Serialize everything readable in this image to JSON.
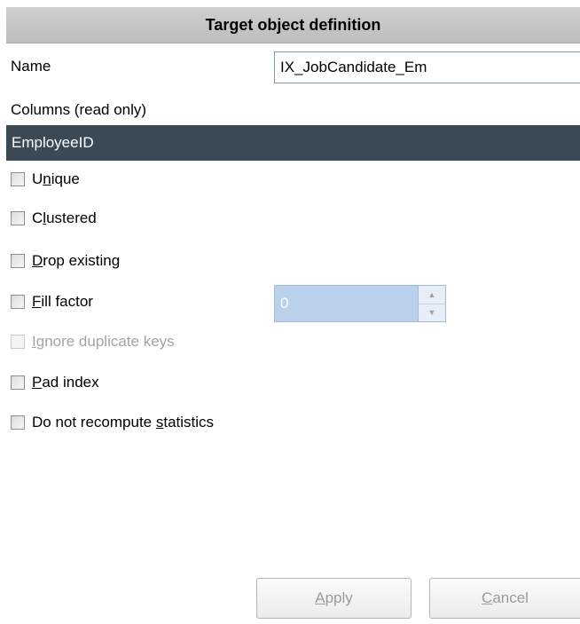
{
  "header": {
    "title": "Target object definition"
  },
  "name_field": {
    "label": "Name",
    "value": "IX_JobCandidate_Em"
  },
  "columns": {
    "label": "Columns (read only)",
    "items": [
      "EmployeeID"
    ]
  },
  "options": {
    "unique": {
      "pre": "U",
      "mnemonic": "n",
      "post": "ique",
      "checked": false
    },
    "clustered": {
      "pre": "C",
      "mnemonic": "l",
      "post": "ustered",
      "checked": false
    },
    "drop_existing": {
      "pre": "",
      "mnemonic": "D",
      "post": "rop existing",
      "checked": false
    },
    "fill_factor": {
      "pre": "",
      "mnemonic": "F",
      "post": "ill factor",
      "checked": false,
      "value": "0"
    },
    "ignore_duplicate_keys": {
      "pre": "",
      "mnemonic": "I",
      "post": "gnore duplicate keys",
      "checked": false,
      "enabled": false
    },
    "pad_index": {
      "pre": "",
      "mnemonic": "P",
      "post": "ad index",
      "checked": false
    },
    "no_recompute": {
      "pre": "Do not recompute ",
      "mnemonic": "s",
      "post": "tatistics",
      "checked": false
    }
  },
  "buttons": {
    "apply": {
      "pre": "",
      "mnemonic": "A",
      "post": "pply"
    },
    "cancel": {
      "pre": "",
      "mnemonic": "C",
      "post": "ancel"
    }
  },
  "icons": {
    "spin_up": "triangle-up",
    "spin_down": "triangle-down"
  }
}
